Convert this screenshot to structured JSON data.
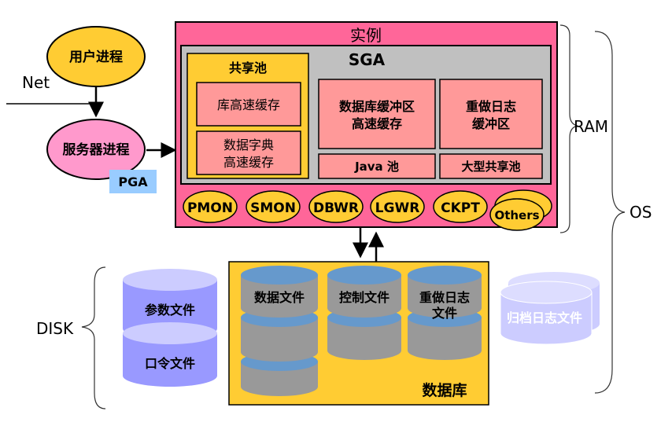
{
  "user_process": "用户进程",
  "net": "Net",
  "server_process": "服务器进程",
  "pga": "PGA",
  "instance_title": "实例",
  "sga_title": "SGA",
  "shared_pool": {
    "title": "共享池",
    "library_cache": "库高速缓存",
    "dict_cache_line1": "数据字典",
    "dict_cache_line2": "高速缓存"
  },
  "db_buffer_line1": "数据库缓冲区",
  "db_buffer_line2": "高速缓存",
  "redo_buffer_line1": "重做日志",
  "redo_buffer_line2": "缓冲区",
  "java_pool": "Java 池",
  "large_pool": "大型共享池",
  "background_processes": [
    "PMON",
    "SMON",
    "DBWR",
    "LGWR",
    "CKPT",
    "Others"
  ],
  "ram": "RAM",
  "os": "OS",
  "disk": "DISK",
  "param_file": "参数文件",
  "password_file": "口令文件",
  "data_file": "数据文件",
  "control_file": "控制文件",
  "redo_file_line1": "重做日志",
  "redo_file_line2": "文件",
  "database_label": "数据库",
  "archive_log": "归档日志文件",
  "colors": {
    "instance_bg": "#ff6699",
    "sga_bg": "#c0c0c0",
    "buffer_bg": "#ff9999",
    "pool_bg": "#ffcc33",
    "process_bg": "#ffcc33",
    "server_bg": "#ff99cc",
    "pga_bg": "#99ccff",
    "cyl_blue": "#6699cc",
    "cyl_body": "#999999",
    "cyl_side": "#9999ff",
    "database_bg": "#ffcc33"
  }
}
